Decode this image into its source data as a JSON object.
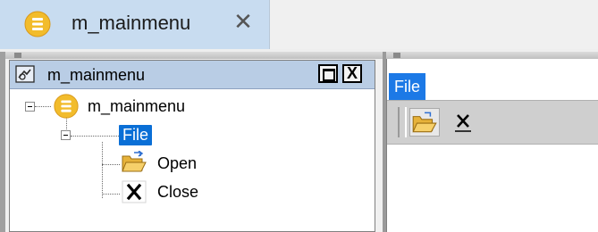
{
  "tab": {
    "title": "m_mainmenu",
    "close_label": "✕"
  },
  "panel": {
    "title": "m_mainmenu",
    "close_label": "X"
  },
  "tree": {
    "root": {
      "label": "m_mainmenu"
    },
    "menu": {
      "label": "File"
    },
    "items": [
      {
        "label": "Open",
        "icon": "open-folder-icon"
      },
      {
        "label": "Close",
        "icon": "close-x-icon"
      }
    ]
  },
  "preview": {
    "menubar": {
      "file_label": "File"
    },
    "toolbar": {
      "close_label": "X"
    }
  },
  "colors": {
    "tab_active_bg": "#c8dcf0",
    "panel_header_bg": "#b9cde5",
    "selection": "#0a6fd6",
    "menu_highlight": "#1c79e6",
    "db_icon": "#f2bc2c"
  }
}
